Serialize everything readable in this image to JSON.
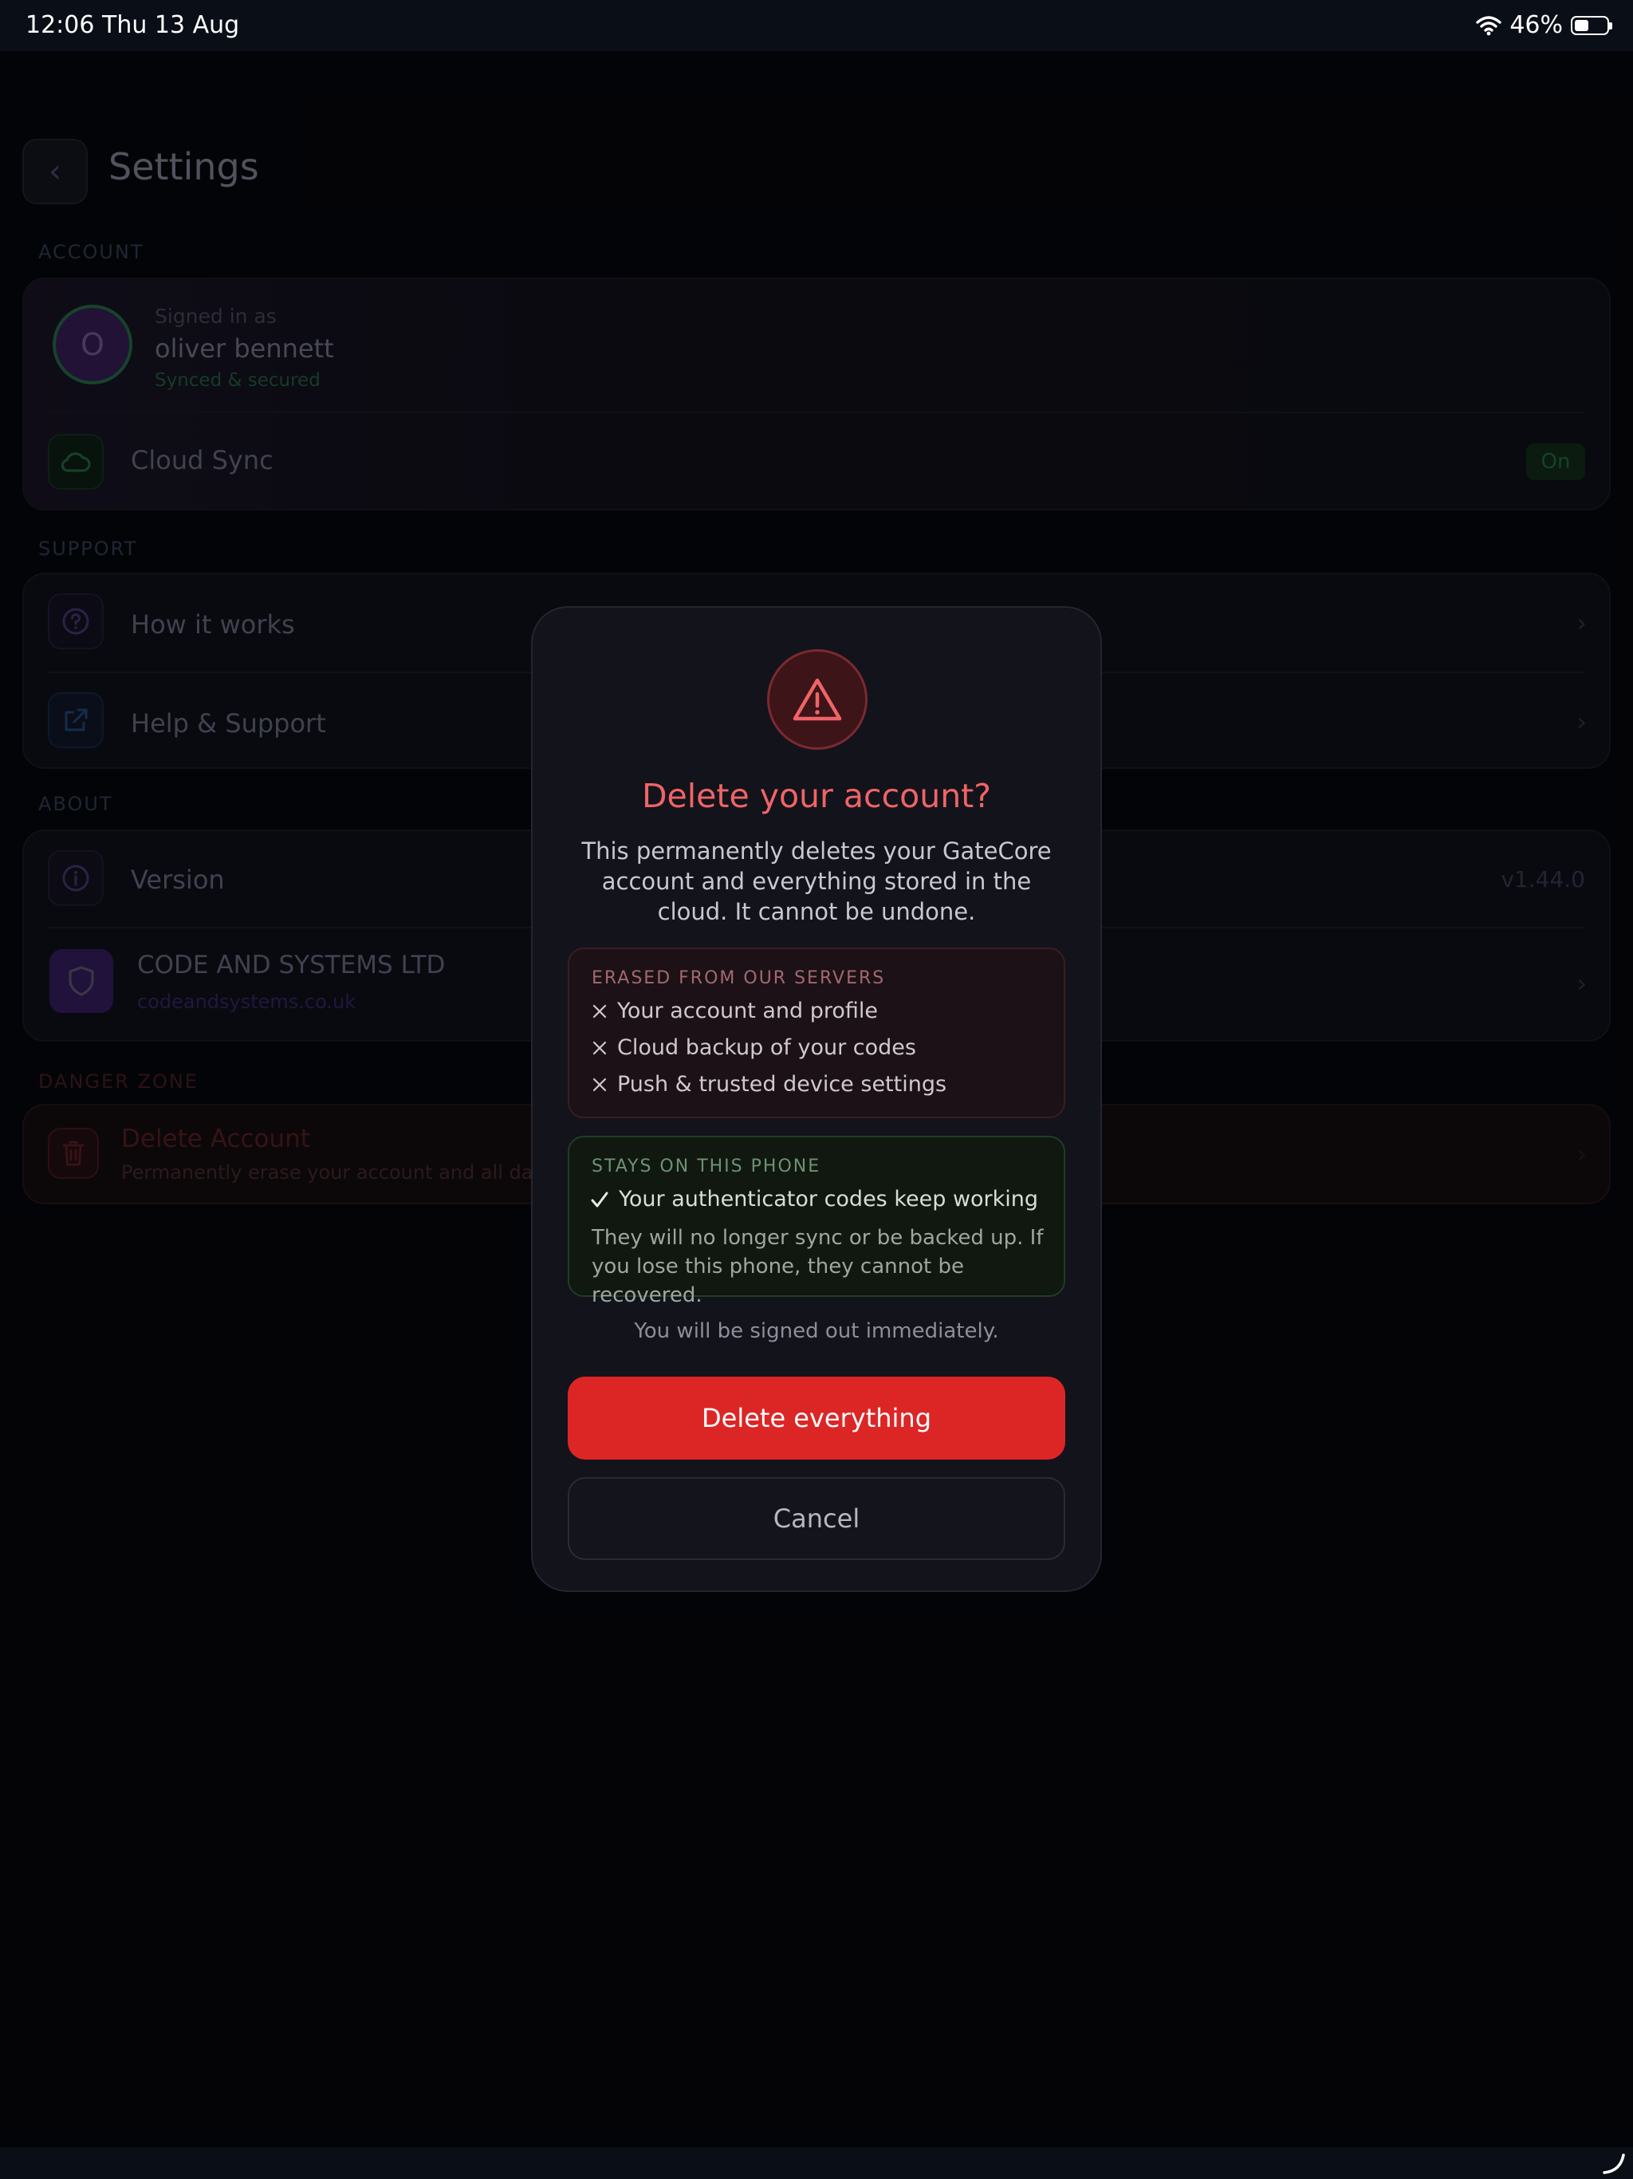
{
  "status_bar": {
    "time": "12:06",
    "date": "Thu 13 Aug",
    "battery": "46%",
    "battery_level": 0.46
  },
  "settings": {
    "title": "Settings",
    "account": {
      "section": "ACCOUNT",
      "signed_in_label": "Signed in as",
      "avatar_initial": "O",
      "name": "oliver bennett",
      "status": "Synced & secured",
      "cloud_sync_label": "Cloud Sync",
      "cloud_sync_state": "On"
    },
    "support": {
      "section": "SUPPORT",
      "items": [
        {
          "label": "How it works"
        },
        {
          "label": "Help & Support"
        }
      ]
    },
    "about": {
      "section": "ABOUT",
      "version_label": "Version",
      "version_value": "v1.44.0",
      "company_name": "CODE AND SYSTEMS LTD",
      "company_url": "codeandsystems.co.uk"
    },
    "danger": {
      "section": "DANGER ZONE",
      "title": "Delete Account",
      "subtitle": "Permanently erase your account and all data"
    }
  },
  "modal": {
    "title": "Delete your account?",
    "description": "This permanently deletes your GateCore account and everything stored in the cloud. It cannot be undone.",
    "erased": {
      "label": "ERASED FROM OUR SERVERS",
      "items": [
        "Your account and profile",
        "Cloud backup of your codes",
        "Push & trusted device settings"
      ]
    },
    "stays": {
      "label": "STAYS ON THIS PHONE",
      "item": "Your authenticator codes keep working",
      "note": "They will no longer sync or be backed up. If you lose this phone, they cannot be recovered."
    },
    "signout_note": "You will be signed out immediately.",
    "confirm_button": "Delete everything",
    "cancel_button": "Cancel"
  },
  "colors": {
    "danger": "#dc2626",
    "danger_text": "#ef6467",
    "background": "#05060a",
    "modal": "#13131b"
  }
}
